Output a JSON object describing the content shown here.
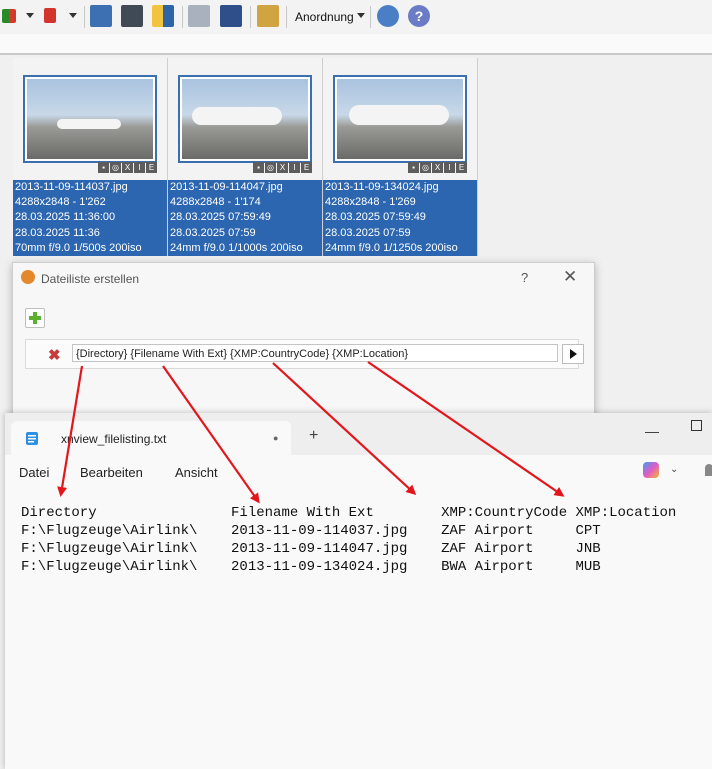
{
  "toolbar": {
    "arrange_label": "Anordnung"
  },
  "thumbnails": [
    {
      "filename": "2013-11-09-114037.jpg",
      "dimensions": "4288x2848 - 1'262",
      "date1": "28.03.2025 11:36:00",
      "date2": "28.03.2025 11:36",
      "exif": "70mm f/9.0 1/500s 200iso"
    },
    {
      "filename": "2013-11-09-114047.jpg",
      "dimensions": "4288x2848 - 1'174",
      "date1": "28.03.2025 07:59:49",
      "date2": "28.03.2025 07:59",
      "exif": "24mm f/9.0 1/1000s 200iso"
    },
    {
      "filename": "2013-11-09-134024.jpg",
      "dimensions": "4288x2848 - 1'269",
      "date1": "28.03.2025 07:59:49",
      "date2": "28.03.2025 07:59",
      "exif": "24mm f/9.0 1/1250s 200iso"
    }
  ],
  "dialog": {
    "title": "Dateiliste erstellen",
    "help": "?",
    "close": "✕",
    "format_field": "{Directory} {Filename With Ext} {XMP:CountryCode} {XMP:Location}"
  },
  "notepad": {
    "tab_title": "xnview_filelisting.txt",
    "menu": [
      "Datei",
      "Bearbeiten",
      "Ansicht"
    ],
    "lines": [
      "Directory                Filename With Ext        XMP:CountryCode XMP:Location",
      "F:\\Flugzeuge\\Airlink\\    2013-11-09-114037.jpg    ZAF Airport     CPT",
      "F:\\Flugzeuge\\Airlink\\    2013-11-09-114047.jpg    ZAF Airport     JNB",
      "F:\\Flugzeuge\\Airlink\\    2013-11-09-134024.jpg    BWA Airport     MUB"
    ]
  },
  "colors": {
    "selection": "#2c66b0",
    "arrow": "#e3161b",
    "delete": "#c63b3b"
  }
}
